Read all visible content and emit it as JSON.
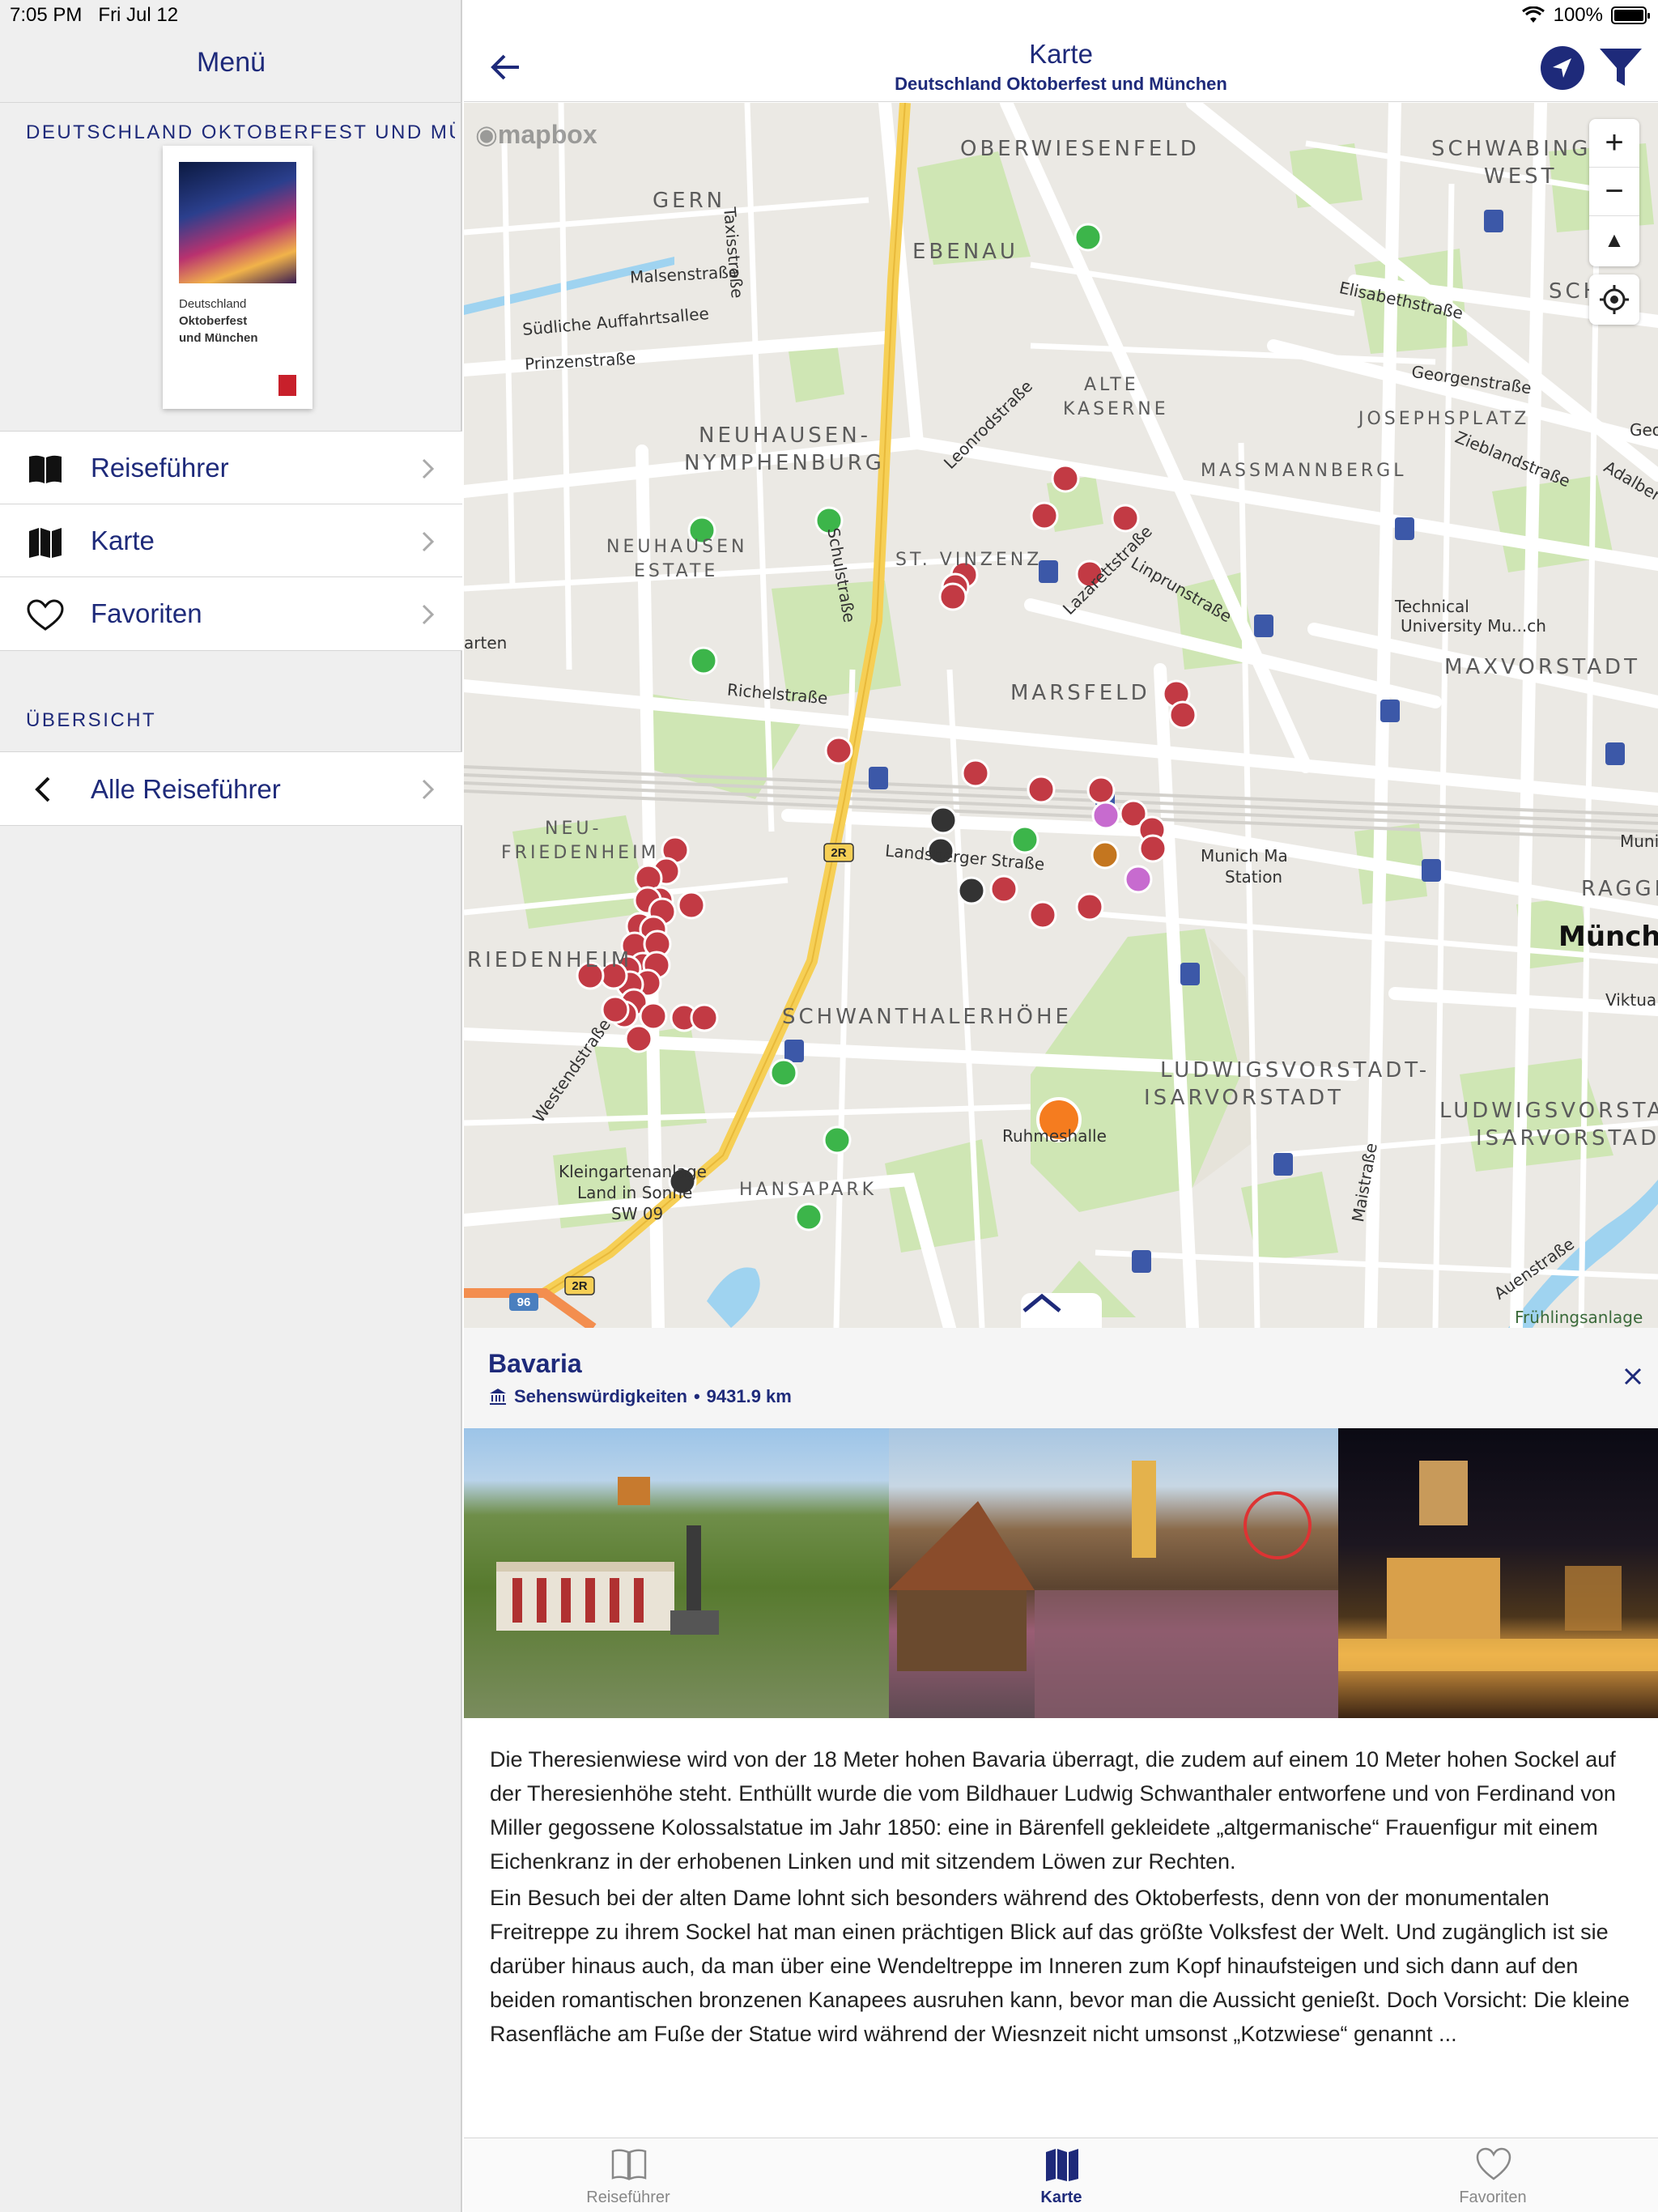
{
  "status_bar": {
    "time": "7:05 PM",
    "date": "Fri Jul 12",
    "battery": "100%"
  },
  "sidebar": {
    "title": "Menü",
    "guide_title": "DEUTSCHLAND OKTOBERFEST UND MÜNCHEN",
    "cover": {
      "line1": "Deutschland",
      "line2": "Oktoberfest",
      "line3": "und München"
    },
    "items": [
      {
        "label": "Reiseführer",
        "icon": "book-icon"
      },
      {
        "label": "Karte",
        "icon": "map-icon"
      },
      {
        "label": "Favoriten",
        "icon": "heart-icon"
      }
    ],
    "section_header": "ÜBERSICHT",
    "all_guides": "Alle Reiseführer"
  },
  "navbar": {
    "title": "Karte",
    "subtitle": "Deutschland Oktoberfest und München"
  },
  "map": {
    "attribution": "mapbox",
    "districts": [
      "OBERWIESENFELD",
      "SCHWABING-",
      "WEST",
      "SCH",
      "GERN",
      "EBENAU",
      "ALTE",
      "KASERNE",
      "NEUHAUSEN-",
      "NYMPHENBURG",
      "JOSEPHSPLATZ",
      "MASSMANNBERGL",
      "NEUHAUSEN",
      "ESTATE",
      "ST. VINZENZ",
      "MAXVORSTADT",
      "MARSFELD",
      "NEU-",
      "FRIEDENHEIM",
      "RAGGE",
      "RIEDENHEIM",
      "SCHWANTHALERHÖHE",
      "LUDWIGSVORSTADT-",
      "ISARVORSTADT",
      "LUDWIGSVORSTA",
      "ISARVORSTAD",
      "HANSAPARK"
    ],
    "streets": [
      "Taxisstraße",
      "Malsenstraße",
      "Südliche Auffahrtsallee",
      "Prinzenstraße",
      "Leonrodstraße",
      "Elisabethstraße",
      "Georgenstraße",
      "Zieblandstraße",
      "Adalber",
      "Geo",
      "Lazarettstraße",
      "Linprunstraße",
      "Schulstraße",
      "arten",
      "Richelstraße",
      "Landsberger Straße",
      "Westendstraße",
      "Maistraße",
      "Auenstraße"
    ],
    "pois": [
      "Technical",
      "University Mu...ch",
      "Munich Ma",
      "Station",
      "Ruhmeshalle",
      "Kleingartenanlage",
      "Land in Sonne",
      "SW 09",
      "Viktualienm",
      "Münch",
      "Muni",
      "Frühlingsanlage"
    ],
    "road_shields": [
      "2R",
      "2R",
      "96"
    ],
    "zoom_in": "+",
    "zoom_out": "−",
    "north": "▲"
  },
  "detail": {
    "name": "Bavaria",
    "category": "Sehenswürdigkeiten",
    "distance": "9431.9 km",
    "paragraph1": "Die Theresienwiese wird von der 18 Meter hohen Bavaria überragt, die zudem auf einem 10 Meter hohen Sockel auf der Theresienhöhe steht. Enthüllt wurde die vom Bildhauer Ludwig Schwanthaler entworfene und von Ferdinand von Miller gegossene Kolossalstatue im Jahr 1850: eine in Bärenfell gekleidete „altgermanische“ Frauenfigur mit einem Eichenkranz in der erhobenen Linken und mit sitzendem Löwen zur Rechten.",
    "paragraph2": "Ein Besuch bei der alten Dame lohnt sich besonders während des Oktoberfests, denn von der monumentalen Freitreppe zu ihrem Sockel hat man einen prächtigen Blick auf das größte Volksfest der Welt. Und zugänglich ist sie darüber hinaus auch, da man über eine Wendeltreppe im Inneren zum Kopf hinaufsteigen und sich dann auf den beiden romantischen bronzenen Kanapees ausruhen kann, bevor man die Aussicht genießt. Doch Vorsicht: Die kleine Rasenfläche am Fuße der Statue wird während der Wiesnzeit nicht umsonst „Kotzwiese“ genannt ..."
  },
  "tabbar": [
    {
      "label": "Reiseführer",
      "icon": "book-icon",
      "active": false
    },
    {
      "label": "Karte",
      "icon": "map-icon",
      "active": true
    },
    {
      "label": "Favoriten",
      "icon": "heart-icon",
      "active": false
    }
  ],
  "colors": {
    "accent": "#1e2a7a",
    "poi_red": "#c23a44",
    "poi_green": "#3cb54a",
    "poi_purple": "#c76bcf",
    "poi_orange": "#f57c1f",
    "poi_brown": "#c4761f",
    "poi_dark": "#333333"
  }
}
